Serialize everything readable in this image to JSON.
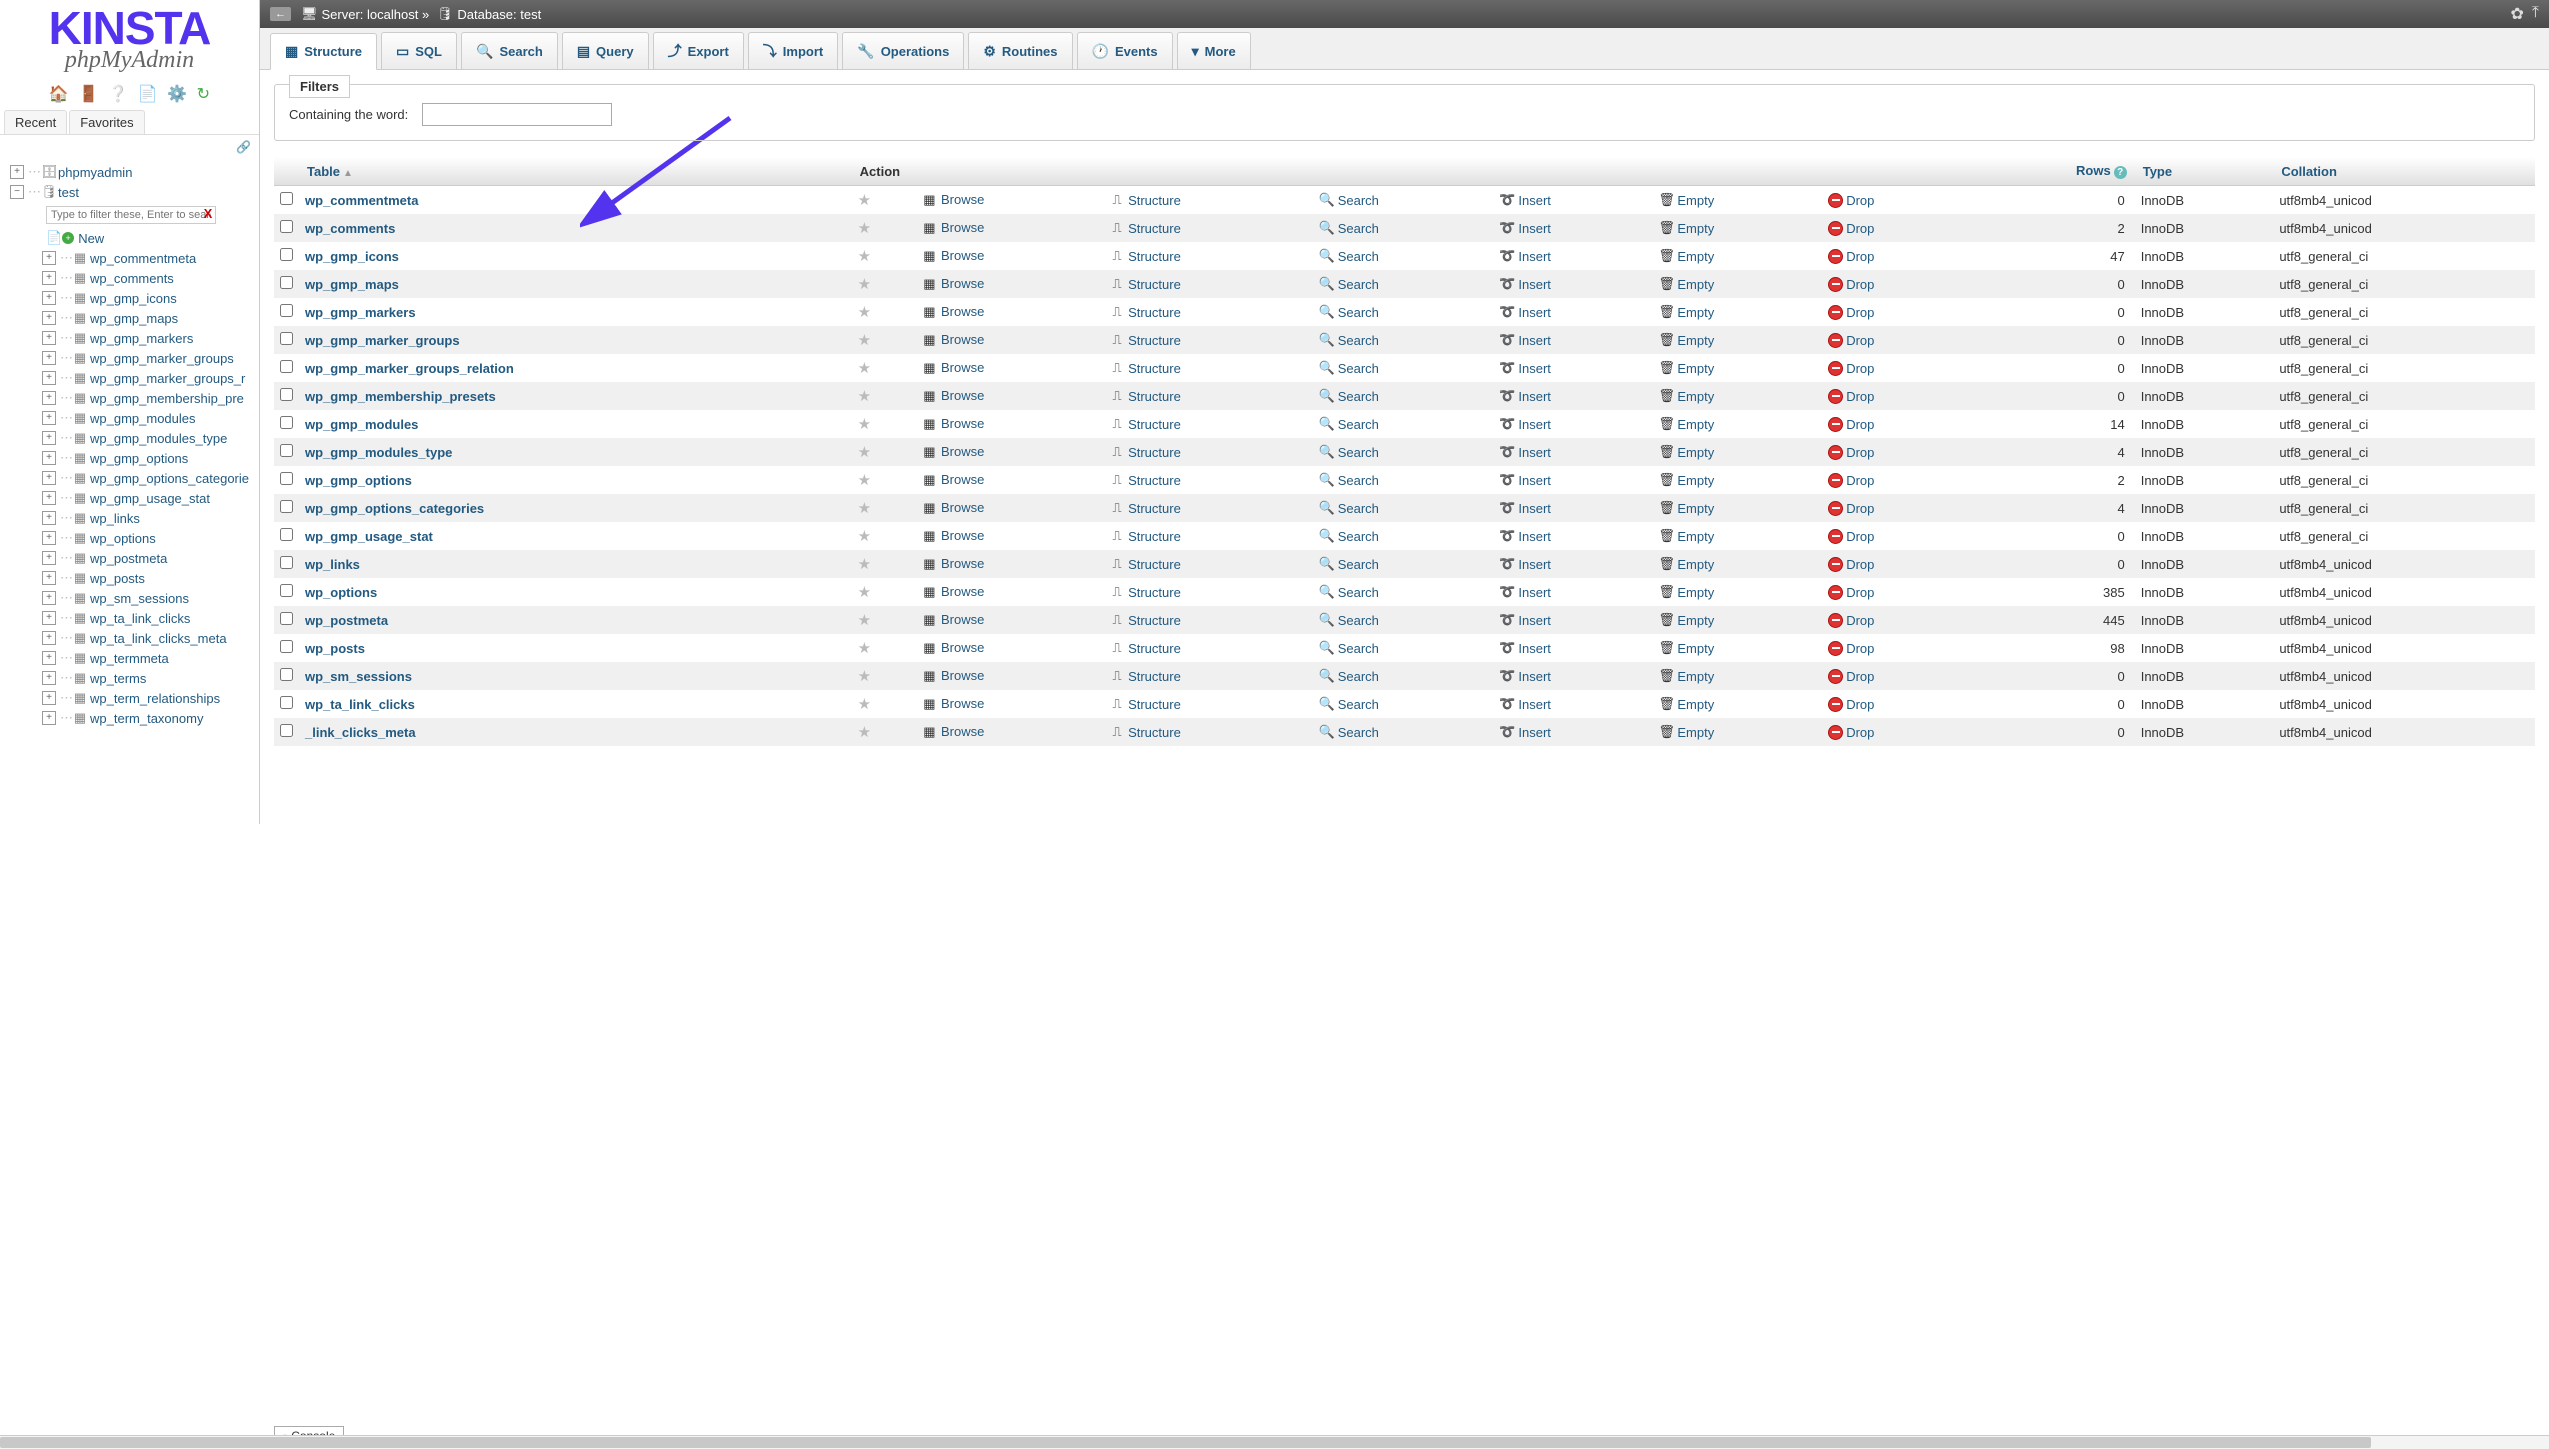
{
  "logo": {
    "top": "KINSTA",
    "sub": "phpMyAdmin"
  },
  "sidebar_tabs": {
    "recent": "Recent",
    "favorites": "Favorites"
  },
  "tree": {
    "root": "phpmyadmin",
    "db": "test",
    "filter_placeholder": "Type to filter these, Enter to search",
    "new_label": "New",
    "tables": [
      "wp_commentmeta",
      "wp_comments",
      "wp_gmp_icons",
      "wp_gmp_maps",
      "wp_gmp_markers",
      "wp_gmp_marker_groups",
      "wp_gmp_marker_groups_r",
      "wp_gmp_membership_pre",
      "wp_gmp_modules",
      "wp_gmp_modules_type",
      "wp_gmp_options",
      "wp_gmp_options_categorie",
      "wp_gmp_usage_stat",
      "wp_links",
      "wp_options",
      "wp_postmeta",
      "wp_posts",
      "wp_sm_sessions",
      "wp_ta_link_clicks",
      "wp_ta_link_clicks_meta",
      "wp_termmeta",
      "wp_terms",
      "wp_term_relationships",
      "wp_term_taxonomy"
    ]
  },
  "breadcrumb": {
    "server_label": "Server:",
    "server": "localhost",
    "sep": "»",
    "db_label": "Database:",
    "db": "test"
  },
  "toptabs": [
    {
      "label": "Structure"
    },
    {
      "label": "SQL"
    },
    {
      "label": "Search"
    },
    {
      "label": "Query"
    },
    {
      "label": "Export"
    },
    {
      "label": "Import"
    },
    {
      "label": "Operations"
    },
    {
      "label": "Routines"
    },
    {
      "label": "Events"
    },
    {
      "label": "More"
    }
  ],
  "filters": {
    "legend": "Filters",
    "label": "Containing the word:"
  },
  "table_headers": {
    "table": "Table",
    "action": "Action",
    "rows": "Rows",
    "type": "Type",
    "collation": "Collation"
  },
  "actions": {
    "browse": "Browse",
    "structure": "Structure",
    "search": "Search",
    "insert": "Insert",
    "empty": "Empty",
    "drop": "Drop"
  },
  "rows": [
    {
      "name": "wp_commentmeta",
      "rows": "0",
      "type": "InnoDB",
      "coll": "utf8mb4_unicod"
    },
    {
      "name": "wp_comments",
      "rows": "2",
      "type": "InnoDB",
      "coll": "utf8mb4_unicod"
    },
    {
      "name": "wp_gmp_icons",
      "rows": "47",
      "type": "InnoDB",
      "coll": "utf8_general_ci"
    },
    {
      "name": "wp_gmp_maps",
      "rows": "0",
      "type": "InnoDB",
      "coll": "utf8_general_ci"
    },
    {
      "name": "wp_gmp_markers",
      "rows": "0",
      "type": "InnoDB",
      "coll": "utf8_general_ci"
    },
    {
      "name": "wp_gmp_marker_groups",
      "rows": "0",
      "type": "InnoDB",
      "coll": "utf8_general_ci"
    },
    {
      "name": "wp_gmp_marker_groups_relation",
      "rows": "0",
      "type": "InnoDB",
      "coll": "utf8_general_ci"
    },
    {
      "name": "wp_gmp_membership_presets",
      "rows": "0",
      "type": "InnoDB",
      "coll": "utf8_general_ci"
    },
    {
      "name": "wp_gmp_modules",
      "rows": "14",
      "type": "InnoDB",
      "coll": "utf8_general_ci"
    },
    {
      "name": "wp_gmp_modules_type",
      "rows": "4",
      "type": "InnoDB",
      "coll": "utf8_general_ci"
    },
    {
      "name": "wp_gmp_options",
      "rows": "2",
      "type": "InnoDB",
      "coll": "utf8_general_ci"
    },
    {
      "name": "wp_gmp_options_categories",
      "rows": "4",
      "type": "InnoDB",
      "coll": "utf8_general_ci"
    },
    {
      "name": "wp_gmp_usage_stat",
      "rows": "0",
      "type": "InnoDB",
      "coll": "utf8_general_ci"
    },
    {
      "name": "wp_links",
      "rows": "0",
      "type": "InnoDB",
      "coll": "utf8mb4_unicod"
    },
    {
      "name": "wp_options",
      "rows": "385",
      "type": "InnoDB",
      "coll": "utf8mb4_unicod"
    },
    {
      "name": "wp_postmeta",
      "rows": "445",
      "type": "InnoDB",
      "coll": "utf8mb4_unicod"
    },
    {
      "name": "wp_posts",
      "rows": "98",
      "type": "InnoDB",
      "coll": "utf8mb4_unicod"
    },
    {
      "name": "wp_sm_sessions",
      "rows": "0",
      "type": "InnoDB",
      "coll": "utf8mb4_unicod"
    },
    {
      "name": "wp_ta_link_clicks",
      "rows": "0",
      "type": "InnoDB",
      "coll": "utf8mb4_unicod"
    },
    {
      "name": "_link_clicks_meta",
      "rows": "0",
      "type": "InnoDB",
      "coll": "utf8mb4_unicod"
    }
  ],
  "console": "Console"
}
